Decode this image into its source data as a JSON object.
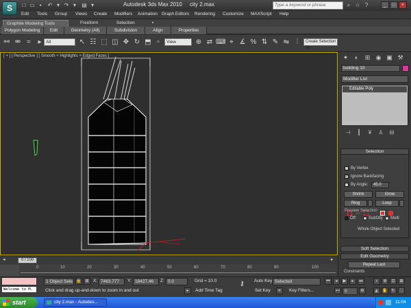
{
  "titlebar": {
    "logo": "S",
    "app_title": "Autodesk 3ds Max  2010",
    "file_title": "city 2.max",
    "search_placeholder": "Type a keyword or phrase"
  },
  "menus": [
    "Edit",
    "Tools",
    "Group",
    "Views",
    "Create",
    "Modifiers",
    "Animation",
    "Graph Editors",
    "Rendering",
    "Customize",
    "MAXScript",
    "Help"
  ],
  "ribbon": {
    "tabs": [
      "Graphite Modeling Tools",
      "Freeform",
      "Selection"
    ],
    "panels": [
      "Polygon Modeling",
      "Edit",
      "Geometry (All)",
      "Subdivision",
      "Align",
      "Properties"
    ]
  },
  "toolbar": {
    "filter_value": "All",
    "refcoord_value": "View",
    "named_selection_value": "Create Selection Se"
  },
  "viewport": {
    "label": "[ + ] [ Perspective ] [ Smooth + Highlights + Edged Faces ]"
  },
  "command_panel": {
    "object_name": "building 10",
    "modifier_list": "Modifier List",
    "stack_item": "Editable Poly",
    "selection_title": "Selection",
    "by_vertex": "By Vertex",
    "ignore_backfacing": "Ignore Backfacing",
    "by_angle": "By Angle:",
    "by_angle_value": "45.0",
    "shrink": "Shrink",
    "grow": "Grow",
    "ring": "Ring",
    "loop": "Loop",
    "preview_selection": "Preview Selection",
    "off": "Off",
    "subobj": "SubObj",
    "multi": "Multi",
    "whole_object": "Whole Object Selected",
    "soft_selection": "Soft Selection",
    "edit_geometry": "Edit Geometry",
    "repeat_last": "Repeat Last",
    "constraints": "Constraints"
  },
  "timeline": {
    "slider": "0 / 100",
    "tick_labels": [
      "0",
      "10",
      "20",
      "30",
      "40",
      "50",
      "60",
      "70",
      "80",
      "90",
      "100"
    ]
  },
  "status": {
    "welcome": "Welcome to M.",
    "selection": "1 Object Sele",
    "x_label": "X:",
    "x_value": "7463.777",
    "y_label": "Y:",
    "y_value": "18427.46",
    "z_label": "Z:",
    "z_value": "0.0",
    "grid": "Grid = 10.0",
    "auto_key": "Auto Key",
    "selected": "Selected",
    "set_key": "Set Key",
    "key_filters": "Key Filters...",
    "hint": "Click and drag up-and-down to zoom in and out",
    "add_time_tag": "Add Time Tag",
    "frame": "0"
  },
  "taskbar": {
    "start": "start",
    "task": "city 2.max - Autodes...",
    "clock": "11:04"
  },
  "colors": {
    "viewport_border": "#c7b700",
    "object_color": "#d63a9a",
    "taskbar": "#245edb"
  }
}
